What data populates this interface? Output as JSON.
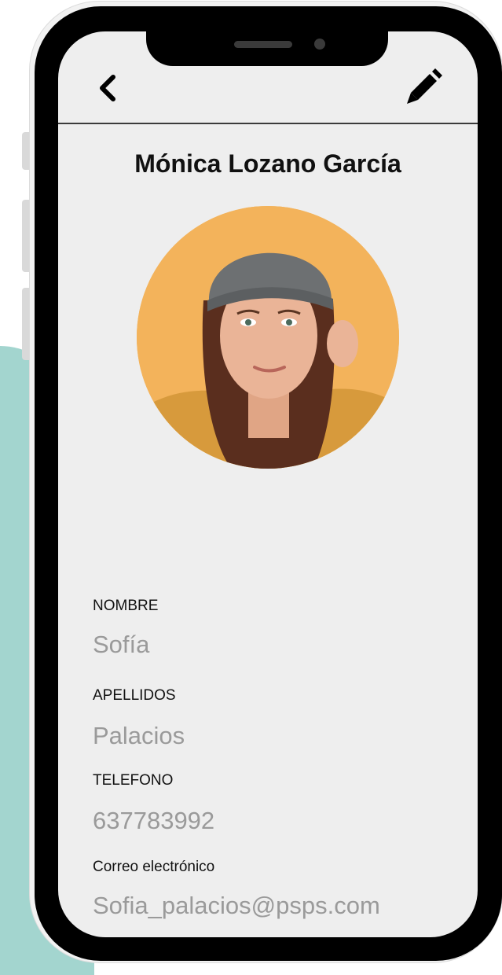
{
  "header": {
    "back_icon": "chevron-left-icon",
    "edit_icon": "pencil-icon"
  },
  "profile": {
    "full_name": "Mónica Lozano García",
    "avatar_icon": "avatar-photo"
  },
  "fields": [
    {
      "label": "NOMBRE",
      "value": "Sofía"
    },
    {
      "label": "APELLIDOS",
      "value": "Palacios"
    },
    {
      "label": "TELEFONO",
      "value": "637783992"
    },
    {
      "label": "Correo electrónico",
      "value": "Sofia_palacios@psps.com"
    }
  ],
  "colors": {
    "screen_background": "#eeeeee",
    "bezel": "#000000",
    "accent_background": "#a3d5cf",
    "value_text": "#9a9a9a",
    "avatar_background": "#f3b35b"
  }
}
